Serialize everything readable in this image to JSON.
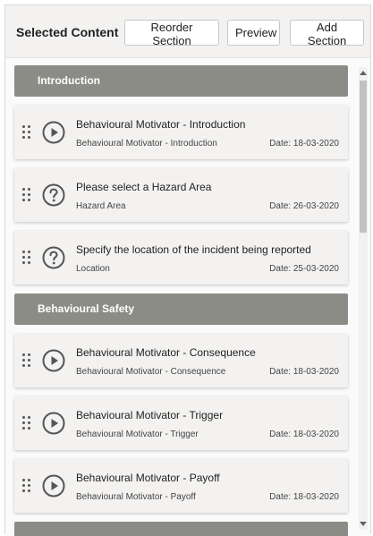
{
  "header": {
    "title": "Selected Content",
    "reorder_label": "Reorder Section",
    "preview_label": "Preview",
    "add_label": "Add Section"
  },
  "sections": [
    {
      "title": "Introduction",
      "items": [
        {
          "title": "Behavioural Motivator - Introduction",
          "subtitle": "Behavioural Motivator - Introduction",
          "date": "Date: 18-03-2020",
          "icon": "play-icon"
        },
        {
          "title": "Please select a Hazard Area",
          "subtitle": "Hazard Area",
          "date": "Date: 26-03-2020",
          "icon": "question-icon"
        },
        {
          "title": "Specify the location of the incident being reported",
          "subtitle": "Location",
          "date": "Date: 25-03-2020",
          "icon": "question-icon"
        }
      ]
    },
    {
      "title": "Behavioural Safety",
      "items": [
        {
          "title": "Behavioural Motivator - Consequence",
          "subtitle": "Behavioural Motivator - Consequence",
          "date": "Date: 18-03-2020",
          "icon": "play-icon"
        },
        {
          "title": "Behavioural Motivator - Trigger",
          "subtitle": "Behavioural Motivator - Trigger",
          "date": "Date: 18-03-2020",
          "icon": "play-icon"
        },
        {
          "title": "Behavioural Motivator - Payoff",
          "subtitle": "Behavioural Motivator - Payoff",
          "date": "Date: 18-03-2020",
          "icon": "play-icon"
        }
      ]
    },
    {
      "title": "",
      "items": []
    }
  ],
  "colors": {
    "section_header_bg": "#8c8c87",
    "card_bg": "#f3f2f1",
    "icon_stroke": "#555555"
  }
}
